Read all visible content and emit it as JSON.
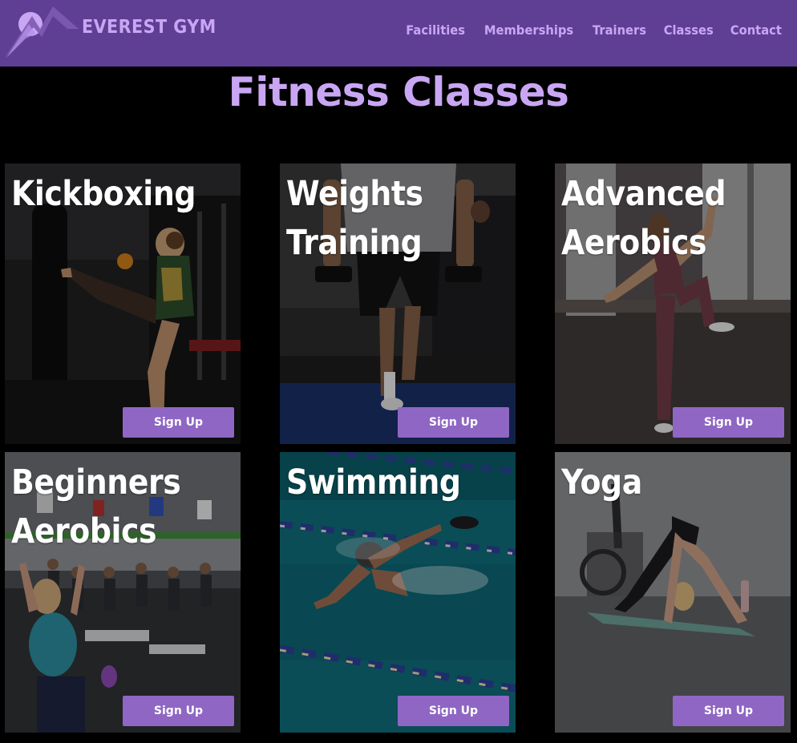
{
  "brand": {
    "name": "EVEREST GYM",
    "logo_icon": "mountain-icon"
  },
  "nav": {
    "items": [
      {
        "label": "Facilities"
      },
      {
        "label": "Memberships"
      },
      {
        "label": "Trainers"
      },
      {
        "label": "Classes"
      },
      {
        "label": "Contact"
      }
    ]
  },
  "page": {
    "title": "Fitness Classes"
  },
  "classes": [
    {
      "title": "Kickboxing",
      "button": "Sign Up",
      "photo": "kickboxer-kicking-bag-photo"
    },
    {
      "title": "Weights Training",
      "button": "Sign Up",
      "photo": "athlete-with-dumbbells-photo"
    },
    {
      "title": "Advanced Aerobics",
      "button": "Sign Up",
      "photo": "woman-high-knee-photo"
    },
    {
      "title": "Beginners Aerobics",
      "button": "Sign Up",
      "photo": "group-stretching-class-photo"
    },
    {
      "title": "Swimming",
      "button": "Sign Up",
      "photo": "swimmer-in-pool-photo"
    },
    {
      "title": "Yoga",
      "button": "Sign Up",
      "photo": "woman-downward-dog-photo"
    }
  ],
  "colors": {
    "navbar": "#5f3f94",
    "accent_text": "#c9a6f3",
    "button": "#8f66c4",
    "background": "#000000"
  }
}
